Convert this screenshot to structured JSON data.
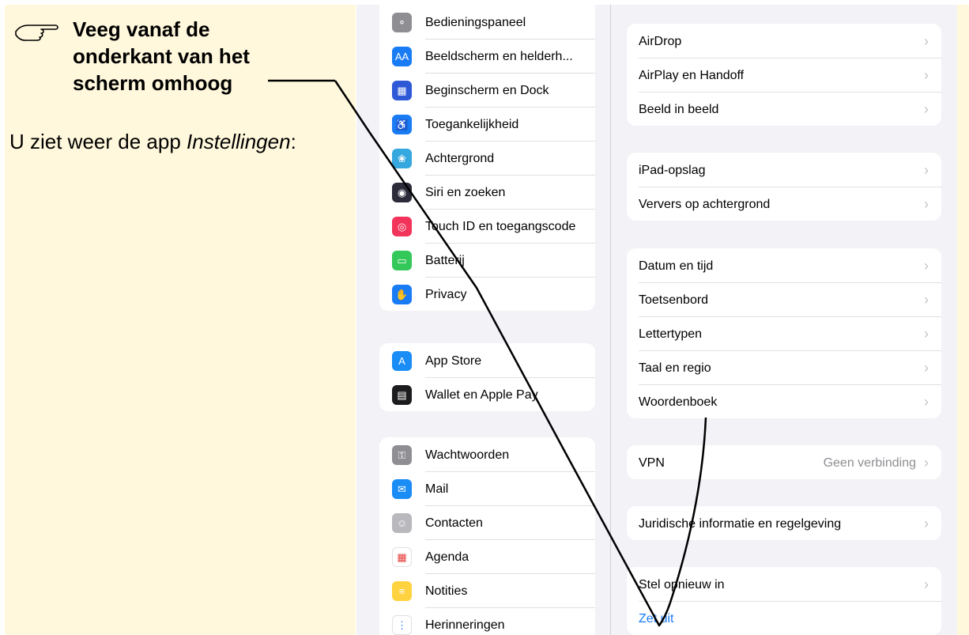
{
  "instruction": {
    "title": "Veeg vanaf de onderkant van het scherm omhoog",
    "body_prefix": "U ziet weer de app ",
    "body_app": "Instellingen",
    "body_suffix": ":"
  },
  "sidebar": {
    "groups": [
      [
        {
          "label": "Bedieningspaneel",
          "icon": "switches-icon",
          "color": "#8e8e93"
        },
        {
          "label": "Beeldscherm en helderh...",
          "icon": "text-size-icon",
          "color": "#1a7cf5"
        },
        {
          "label": "Beginscherm en Dock",
          "icon": "home-grid-icon",
          "color": "#2f58d6"
        },
        {
          "label": "Toegankelijkheid",
          "icon": "accessibility-icon",
          "color": "#1a7cf5"
        },
        {
          "label": "Achtergrond",
          "icon": "flower-icon",
          "color": "#35a8e0"
        },
        {
          "label": "Siri en zoeken",
          "icon": "siri-icon",
          "color": "#2b2b3a"
        },
        {
          "label": "Touch ID en toegangscode",
          "icon": "fingerprint-icon",
          "color": "#f2335a"
        },
        {
          "label": "Batterij",
          "icon": "battery-icon",
          "color": "#34c759"
        },
        {
          "label": "Privacy",
          "icon": "hand-icon",
          "color": "#1a7cf5"
        }
      ],
      [
        {
          "label": "App Store",
          "icon": "app-store-icon",
          "color": "#1a8cf5"
        },
        {
          "label": "Wallet en Apple Pay",
          "icon": "wallet-icon",
          "color": "#1c1c1e"
        }
      ],
      [
        {
          "label": "Wachtwoorden",
          "icon": "key-icon",
          "color": "#8e8e93"
        },
        {
          "label": "Mail",
          "icon": "mail-icon",
          "color": "#1a8cf5"
        },
        {
          "label": "Contacten",
          "icon": "contacts-icon",
          "color": "#b8b8bd"
        },
        {
          "label": "Agenda",
          "icon": "calendar-icon",
          "color": "#ffffff"
        },
        {
          "label": "Notities",
          "icon": "notes-icon",
          "color": "#ffd23f"
        },
        {
          "label": "Herinneringen",
          "icon": "reminders-icon",
          "color": "#ffffff"
        }
      ]
    ]
  },
  "detail": {
    "groups": [
      [
        {
          "label": "AirDrop"
        },
        {
          "label": "AirPlay en Handoff"
        },
        {
          "label": "Beeld in beeld"
        }
      ],
      [
        {
          "label": "iPad-opslag"
        },
        {
          "label": "Ververs op achtergrond"
        }
      ],
      [
        {
          "label": "Datum en tijd"
        },
        {
          "label": "Toetsenbord"
        },
        {
          "label": "Lettertypen"
        },
        {
          "label": "Taal en regio"
        },
        {
          "label": "Woordenboek"
        }
      ],
      [
        {
          "label": "VPN",
          "value": "Geen verbinding"
        }
      ],
      [
        {
          "label": "Juridische informatie en regelgeving"
        }
      ],
      [
        {
          "label": "Stel opnieuw in"
        },
        {
          "label": "Zet uit",
          "action": true
        }
      ]
    ]
  },
  "colors": {
    "instruction_bg": "#fff8dc",
    "settings_bg": "#f2f2f7",
    "accent_blue": "#1a7cf5"
  }
}
